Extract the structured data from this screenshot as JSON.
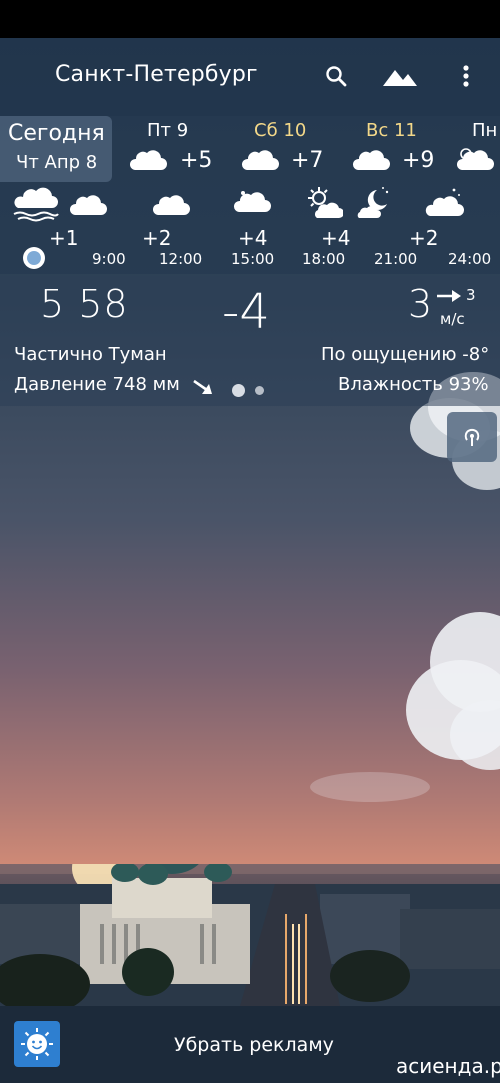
{
  "header": {
    "city": "Санкт-Петербург",
    "icons": {
      "search": "search-icon",
      "landscape": "landscape-icon",
      "menu": "more-vert-icon"
    }
  },
  "today": {
    "title": "Сегодня",
    "date": "Чт Апр 8"
  },
  "days": [
    {
      "name": "Пт 9",
      "temp": "+5",
      "icon": "cloud-icon"
    },
    {
      "name": "Сб 10",
      "temp": "+7",
      "icon": "cloud-icon"
    },
    {
      "name": "Вс 11",
      "temp": "+9",
      "icon": "cloud-icon"
    },
    {
      "name": "Пн",
      "temp": "",
      "icon": "partly-sunny-icon"
    }
  ],
  "hourly": [
    {
      "temp": "+1",
      "time": "",
      "icon": "fog-icon"
    },
    {
      "temp": "",
      "time": "9:00",
      "icon": "cloud-icon"
    },
    {
      "temp": "+2",
      "time": "12:00",
      "icon": "cloud-icon"
    },
    {
      "temp": "+4",
      "time": "15:00",
      "icon": "cloud-icon"
    },
    {
      "temp": "+4",
      "time": "18:00",
      "icon": "sun-cloud-icon"
    },
    {
      "temp": "+2",
      "time": "21:00",
      "icon": "moon-cloud-icon"
    },
    {
      "temp": "",
      "time": "24:00",
      "icon": "cloud-night-icon"
    }
  ],
  "current": {
    "time": "5 58",
    "temp": "-4",
    "wind_speed": "3",
    "wind_gust": "3",
    "wind_unit": "м/с",
    "condition": "Частично Туман",
    "feels_like": "По ощущению -8°",
    "pressure": "Давление 748 мм",
    "humidity": "Влажность 93%"
  },
  "bottom": {
    "remove_ads": "Убрать рекламу",
    "watermark": "асиенда.ру"
  },
  "colors": {
    "saturday": "#f3d889",
    "bottom_bar": "#1c2a3a",
    "app_icon": "#2e7fd0"
  }
}
